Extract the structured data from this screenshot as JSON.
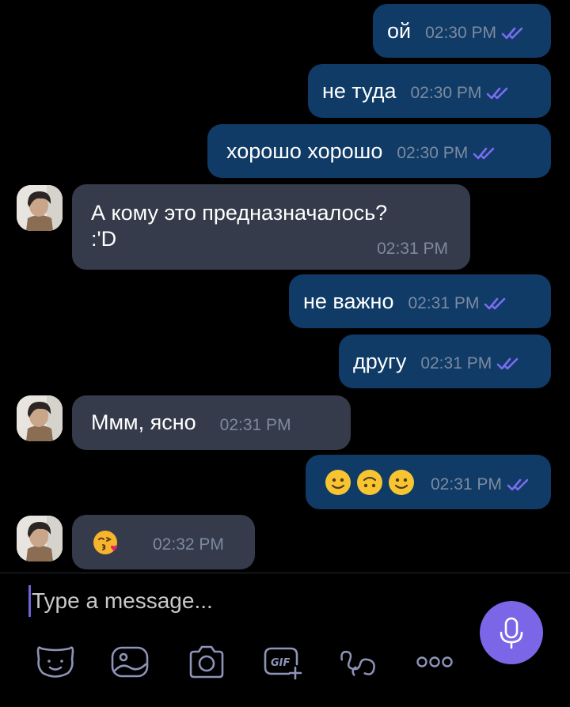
{
  "colors": {
    "outgoing_bubble": "#0f3b66",
    "incoming_bubble": "#353b4a",
    "read_ticks": "#7b6cf0",
    "mic_button": "#7b66e8"
  },
  "messages": [
    {
      "direction": "outgoing",
      "text": "ой",
      "time": "02:30 PM",
      "status": "read"
    },
    {
      "direction": "outgoing",
      "text": "не туда",
      "time": "02:30 PM",
      "status": "read"
    },
    {
      "direction": "outgoing",
      "text": "хорошо хорошо",
      "time": "02:30 PM",
      "status": "read"
    },
    {
      "direction": "incoming",
      "text_line1": "А кому это  предназначалось?",
      "text_line2": ":'D",
      "time": "02:31 PM"
    },
    {
      "direction": "outgoing",
      "text": "не важно",
      "time": "02:31 PM",
      "status": "read"
    },
    {
      "direction": "outgoing",
      "text": "другу",
      "time": "02:31 PM",
      "status": "read"
    },
    {
      "direction": "incoming",
      "text": "Ммм, ясно",
      "time": "02:31 PM"
    },
    {
      "direction": "outgoing",
      "emojis": [
        "slightly-smiling-face",
        "upside-down-face",
        "slightly-smiling-face"
      ],
      "time": "02:31 PM",
      "status": "read"
    },
    {
      "direction": "incoming",
      "emojis": [
        "face-blowing-kiss"
      ],
      "time": "02:32 PM"
    }
  ],
  "composer": {
    "placeholder": "Type a message...",
    "toolbar_icons": [
      "sticker-icon",
      "gallery-icon",
      "camera-icon",
      "gif-icon",
      "doodle-icon",
      "more-icon"
    ],
    "gif_label": "GIF",
    "send_button_icon": "microphone-icon"
  }
}
